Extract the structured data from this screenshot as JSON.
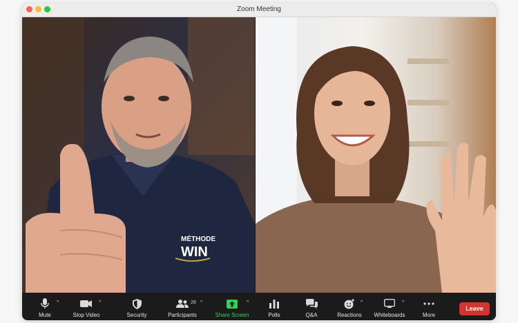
{
  "window": {
    "title": "Zoom Meeting"
  },
  "toolbar": {
    "mute_label": "Mute",
    "stop_video_label": "Stop Video",
    "security_label": "Security",
    "participants_label": "Participants",
    "participants_count": "28",
    "share_screen_label": "Share Screen",
    "polls_label": "Polls",
    "qa_label": "Q&A",
    "reactions_label": "Reactions",
    "whiteboards_label": "Whiteboards",
    "more_label": "More",
    "leave_label": "Leave",
    "caret": "^"
  },
  "participants": {
    "left_shirt_logo_top": "MÉTHODE",
    "left_shirt_logo_main": "WIN"
  },
  "colors": {
    "leave": "#d6322f",
    "share_screen": "#35d058",
    "toolbar_bg": "#1b1b1b"
  }
}
